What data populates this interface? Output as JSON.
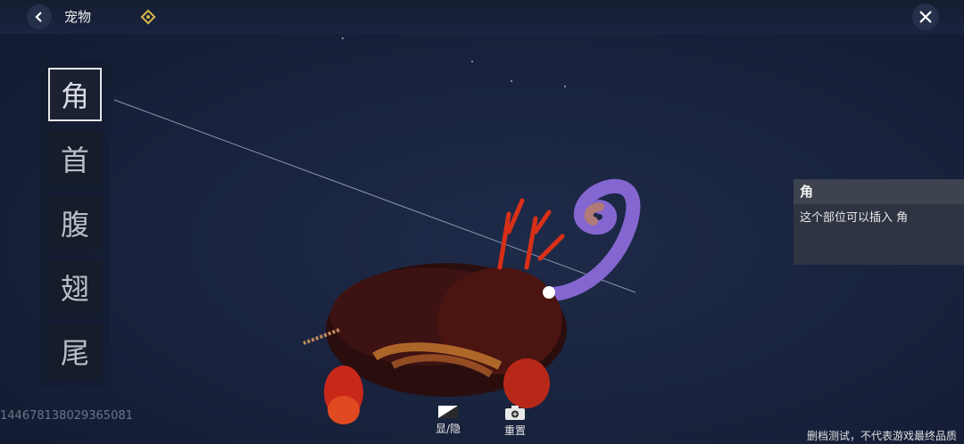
{
  "header": {
    "title": "宠物",
    "back_icon": "chevron-left-icon",
    "badge_icon": "diamond-icon",
    "close_icon": "close-icon"
  },
  "parts": [
    {
      "label": "角",
      "selected": true
    },
    {
      "label": "首",
      "selected": false
    },
    {
      "label": "腹",
      "selected": false
    },
    {
      "label": "翅",
      "selected": false
    },
    {
      "label": "尾",
      "selected": false
    }
  ],
  "info_panel": {
    "title": "角",
    "description": "这个部位可以插入 角"
  },
  "uid": "1446781380293650​81",
  "actions": {
    "toggle_label": "显/隐",
    "toggle_icon": "show-hide-icon",
    "reset_label": "重置",
    "reset_icon": "camera-icon"
  },
  "disclaimer": "删档测试，不代表游戏最终品质",
  "colors": {
    "background": "#18223c",
    "creature_body": "#3a1010",
    "creature_glow": "#d8321a",
    "tail": "#7a5cc8"
  }
}
